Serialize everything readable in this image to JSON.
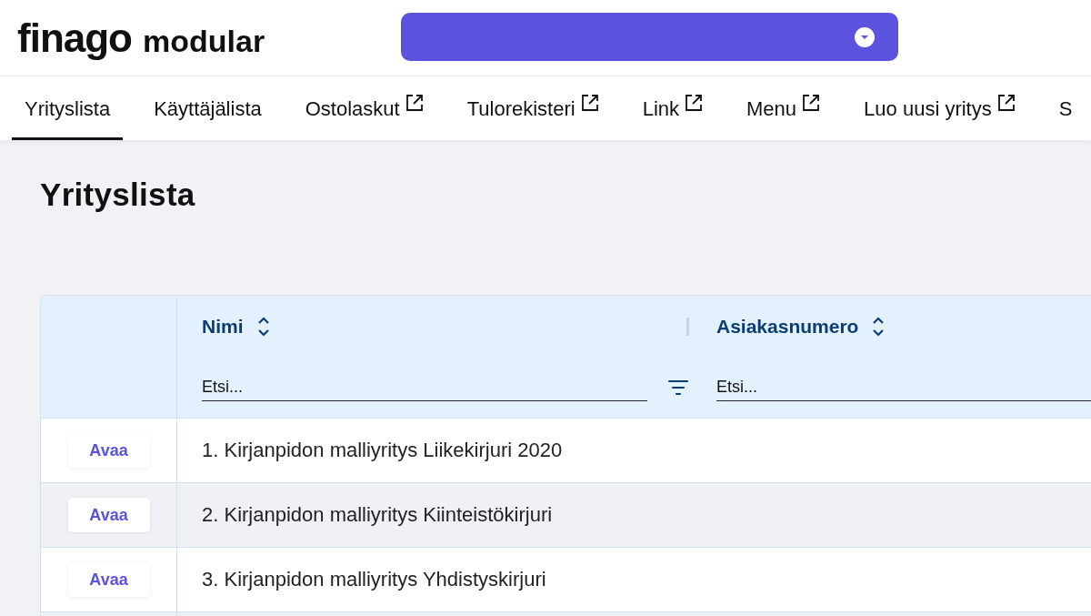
{
  "logo": {
    "brand": "finago",
    "product": "modular"
  },
  "tabs": [
    {
      "label": "Yrityslista",
      "selected": true,
      "external": false
    },
    {
      "label": "Käyttäjälista",
      "selected": false,
      "external": false
    },
    {
      "label": "Ostolaskut",
      "selected": false,
      "external": true
    },
    {
      "label": "Tulorekisteri",
      "selected": false,
      "external": true
    },
    {
      "label": "Link",
      "selected": false,
      "external": true
    },
    {
      "label": "Menu",
      "selected": false,
      "external": true
    },
    {
      "label": "Luo uusi yritys",
      "selected": false,
      "external": true
    },
    {
      "label": "S",
      "selected": false,
      "external": false
    }
  ],
  "page_title": "Yrityslista",
  "table": {
    "columns": [
      {
        "label": "Nimi",
        "filter_placeholder": "Etsi...",
        "filter_button": true
      },
      {
        "label": "Asiakasnumero",
        "filter_placeholder": "Etsi...",
        "filter_button": false
      }
    ],
    "rows": [
      {
        "action": "Avaa",
        "name": "1. Kirjanpidon malliyritys Liikekirjuri 2020"
      },
      {
        "action": "Avaa",
        "name": "2. Kirjanpidon malliyritys Kiinteistökirjuri"
      },
      {
        "action": "Avaa",
        "name": "3. Kirjanpidon malliyritys Yhdistyskirjuri"
      }
    ]
  }
}
